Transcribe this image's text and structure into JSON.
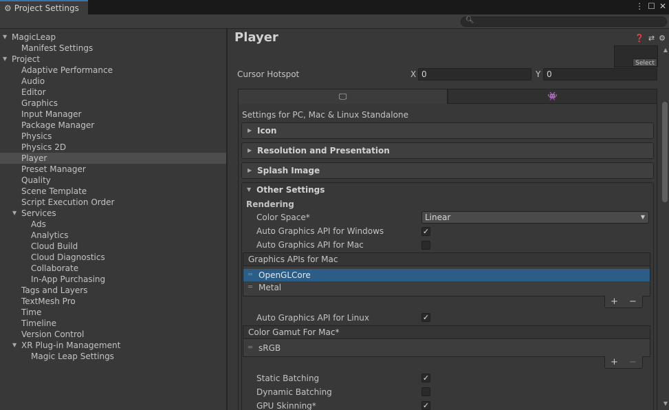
{
  "window": {
    "tab_title": "Project Settings",
    "menu_icon": "kebab-menu-icon",
    "maximize_icon": "maximize-icon",
    "close_icon": "close-icon"
  },
  "search": {
    "placeholder": "",
    "value": ""
  },
  "sidebar": {
    "items": [
      {
        "label": "MagicLeap",
        "level": 0,
        "expanded": true
      },
      {
        "label": "Manifest Settings",
        "level": 1
      },
      {
        "label": "Project",
        "level": 0,
        "expanded": true
      },
      {
        "label": "Adaptive Performance",
        "level": 1
      },
      {
        "label": "Audio",
        "level": 1
      },
      {
        "label": "Editor",
        "level": 1
      },
      {
        "label": "Graphics",
        "level": 1
      },
      {
        "label": "Input Manager",
        "level": 1
      },
      {
        "label": "Package Manager",
        "level": 1
      },
      {
        "label": "Physics",
        "level": 1
      },
      {
        "label": "Physics 2D",
        "level": 1
      },
      {
        "label": "Player",
        "level": 1,
        "selected": true
      },
      {
        "label": "Preset Manager",
        "level": 1
      },
      {
        "label": "Quality",
        "level": 1
      },
      {
        "label": "Scene Template",
        "level": 1
      },
      {
        "label": "Script Execution Order",
        "level": 1
      },
      {
        "label": "Services",
        "level": 1,
        "expanded": true
      },
      {
        "label": "Ads",
        "level": 2
      },
      {
        "label": "Analytics",
        "level": 2
      },
      {
        "label": "Cloud Build",
        "level": 2
      },
      {
        "label": "Cloud Diagnostics",
        "level": 2
      },
      {
        "label": "Collaborate",
        "level": 2
      },
      {
        "label": "In-App Purchasing",
        "level": 2
      },
      {
        "label": "Tags and Layers",
        "level": 1
      },
      {
        "label": "TextMesh Pro",
        "level": 1
      },
      {
        "label": "Time",
        "level": 1
      },
      {
        "label": "Timeline",
        "level": 1
      },
      {
        "label": "Version Control",
        "level": 1
      },
      {
        "label": "XR Plug-in Management",
        "level": 1,
        "expanded": true
      },
      {
        "label": "Magic Leap Settings",
        "level": 2
      }
    ]
  },
  "main": {
    "title": "Player",
    "select_label": "Select",
    "cursor_hotspot": {
      "label": "Cursor Hotspot",
      "x_label": "X",
      "x_value": "0",
      "y_label": "Y",
      "y_value": "0"
    },
    "platform_tabs": [
      {
        "icon": "monitor-icon",
        "active": true
      },
      {
        "icon": "android-icon",
        "active": false
      }
    ],
    "settings_for": "Settings for PC, Mac & Linux Standalone",
    "foldouts": [
      {
        "label": "Icon",
        "expanded": false
      },
      {
        "label": "Resolution and Presentation",
        "expanded": false
      },
      {
        "label": "Splash Image",
        "expanded": false
      },
      {
        "label": "Other Settings",
        "expanded": true
      }
    ],
    "rendering": {
      "header": "Rendering",
      "color_space_label": "Color Space*",
      "color_space_value": "Linear",
      "auto_api_windows_label": "Auto Graphics API  for Windows",
      "auto_api_windows": true,
      "auto_api_mac_label": "Auto Graphics API  for Mac",
      "auto_api_mac": false,
      "mac_apis": {
        "header": "Graphics APIs for Mac",
        "items": [
          "OpenGLCore",
          "Metal"
        ],
        "selected": 0
      },
      "auto_api_linux_label": "Auto Graphics API  for Linux",
      "auto_api_linux": true,
      "gamut": {
        "header": "Color Gamut For Mac*",
        "items": [
          "sRGB"
        ]
      },
      "static_batching_label": "Static Batching",
      "static_batching": true,
      "dynamic_batching_label": "Dynamic Batching",
      "dynamic_batching": false,
      "gpu_skinning_label": "GPU Skinning*",
      "gpu_skinning": true
    },
    "plus": "+",
    "minus": "−",
    "check_mark": "✓"
  }
}
